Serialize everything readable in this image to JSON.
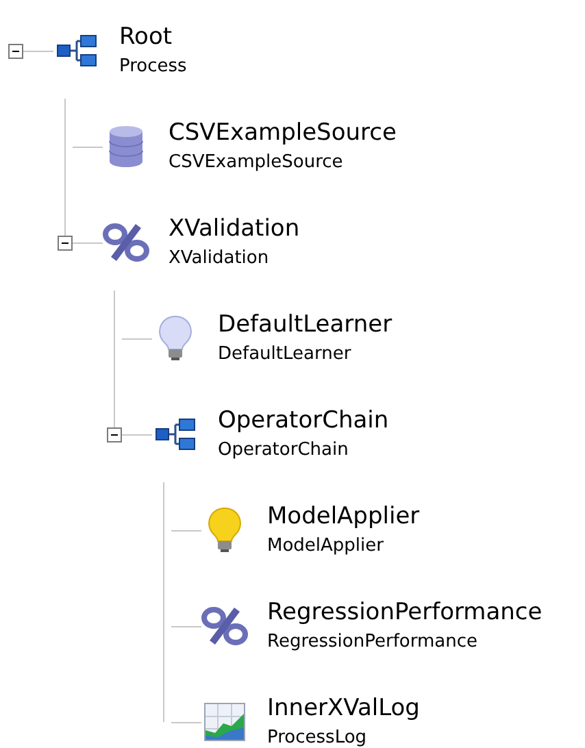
{
  "tree": {
    "name": "Root",
    "type": "Process",
    "kind": "chain",
    "expanded": true,
    "children": [
      {
        "name": "CSVExampleSource",
        "type": "CSVExampleSource",
        "kind": "source"
      },
      {
        "name": "XValidation",
        "type": "XValidation",
        "kind": "percent",
        "expanded": true,
        "children": [
          {
            "name": "DefaultLearner",
            "type": "DefaultLearner",
            "kind": "learner"
          },
          {
            "name": "OperatorChain",
            "type": "OperatorChain",
            "kind": "chain",
            "expanded": true,
            "children": [
              {
                "name": "ModelApplier",
                "type": "ModelApplier",
                "kind": "applier"
              },
              {
                "name": "RegressionPerformance",
                "type": "RegressionPerformance",
                "kind": "percent"
              },
              {
                "name": "InnerXValLog",
                "type": "ProcessLog",
                "kind": "log"
              }
            ]
          }
        ]
      }
    ]
  }
}
